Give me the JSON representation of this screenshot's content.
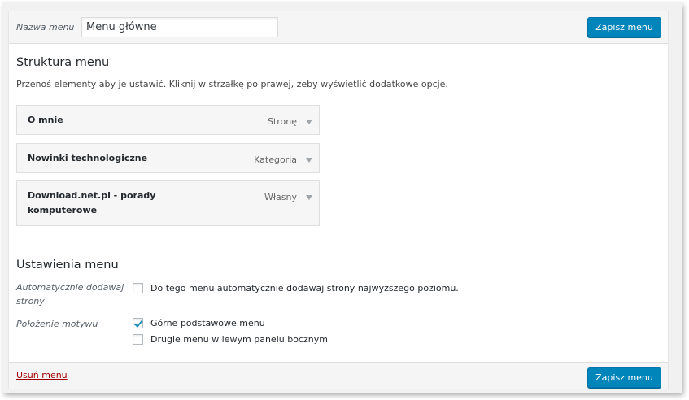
{
  "header": {
    "name_label": "Nazwa menu",
    "name_value": "Menu główne",
    "save_label": "Zapisz menu"
  },
  "structure": {
    "title": "Struktura menu",
    "instructions": "Przenoś elementy aby je ustawić. Kliknij w strzałkę po prawej, żeby wyświetlić dodatkowe opcje.",
    "items": [
      {
        "title": "O mnie",
        "type": "Stronę"
      },
      {
        "title": "Nowinki technologiczne",
        "type": "Kategoria"
      },
      {
        "title": "Download.net.pl - porady komputerowe",
        "type": "Własny"
      }
    ]
  },
  "settings": {
    "title": "Ustawienia menu",
    "auto_add_label": "Automatycznie dodawaj strony",
    "auto_add_option": {
      "label": "Do tego menu automatycznie dodawaj strony najwyższego poziomu.",
      "checked": false
    },
    "location_label": "Położenie motywu",
    "locations": [
      {
        "label": "Górne podstawowe menu",
        "checked": true
      },
      {
        "label": "Drugie menu w lewym panelu bocznym",
        "checked": false
      }
    ]
  },
  "footer": {
    "delete_label": "Usuń menu",
    "save_label": "Zapisz menu"
  },
  "colors": {
    "primary_button": "#0085ba",
    "delete_link": "#a00000",
    "checkmark": "#1e8cbe"
  },
  "icons": {
    "item_toggle": "arrow-down-icon",
    "checkbox_checked": "check-icon"
  }
}
